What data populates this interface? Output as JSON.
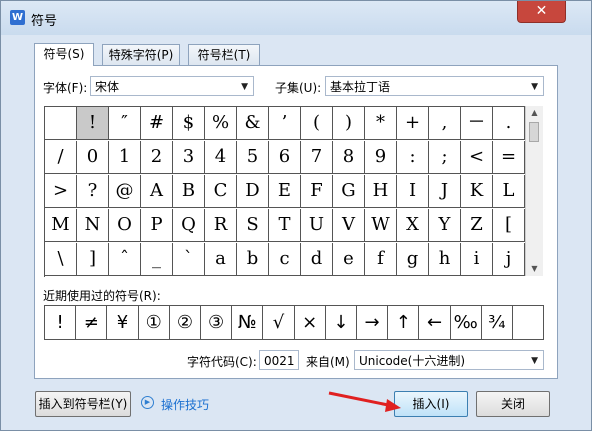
{
  "window": {
    "title": "符号",
    "app_icon": "W",
    "close_glyph": "✕"
  },
  "tabs": [
    "符号(S)",
    "特殊字符(P)",
    "符号栏(T)"
  ],
  "font": {
    "label": "字体(F):",
    "value": "宋体"
  },
  "subset": {
    "label": "子集(U):",
    "value": "基本拉丁语"
  },
  "symbols": [
    [
      "",
      "!",
      "″",
      "#",
      "$",
      "%",
      "&",
      "’",
      "(",
      ")",
      "*",
      "+",
      ",",
      "－",
      "."
    ],
    [
      "/",
      "0",
      "1",
      "2",
      "3",
      "4",
      "5",
      "6",
      "7",
      "8",
      "9",
      ":",
      ";",
      "<",
      "="
    ],
    [
      ">",
      "?",
      "@",
      "A",
      "B",
      "C",
      "D",
      "E",
      "F",
      "G",
      "H",
      "I",
      "J",
      "K",
      "L"
    ],
    [
      "M",
      "N",
      "O",
      "P",
      "Q",
      "R",
      "S",
      "T",
      "U",
      "V",
      "W",
      "X",
      "Y",
      "Z",
      "["
    ],
    [
      "\\",
      "]",
      "ˆ",
      "_",
      "`",
      "a",
      "b",
      "c",
      "d",
      "e",
      "f",
      "g",
      "h",
      "i",
      "j"
    ]
  ],
  "selected_symbol": "!",
  "recent": {
    "label": "近期使用过的符号(R):",
    "items": [
      "!",
      "≠",
      "¥",
      "①",
      "②",
      "③",
      "№",
      "√",
      "×",
      "↓",
      "→",
      "↑",
      "←",
      "‰",
      "¾",
      ""
    ]
  },
  "char_code": {
    "label": "字符代码(C):",
    "value": "0021"
  },
  "from": {
    "label": "来自(M)",
    "value": "Unicode(十六进制)"
  },
  "buttons": {
    "insert_to_bar": "插入到符号栏(Y)",
    "tips": "操作技巧",
    "insert": "插入(I)",
    "close": "关闭"
  },
  "colors": {
    "accent_link": "#1a6fd0",
    "annotation_arrow": "#e02020",
    "selected_cell": "#c9c9c9"
  }
}
